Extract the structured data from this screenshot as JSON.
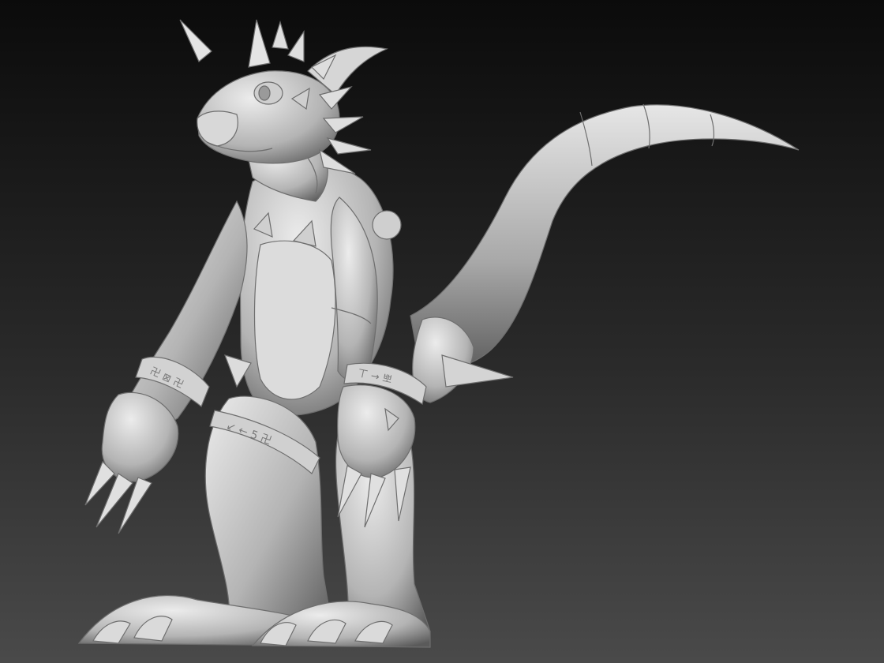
{
  "scene": {
    "subject": "sculpted dragon creature model",
    "background": {
      "top": "#0b0b0b",
      "bottom": "#4a4a4a"
    },
    "material": {
      "light": "#ececec",
      "mid": "#b4b4b4",
      "dark": "#5a5a5a",
      "line": "#6e6e6e"
    }
  }
}
